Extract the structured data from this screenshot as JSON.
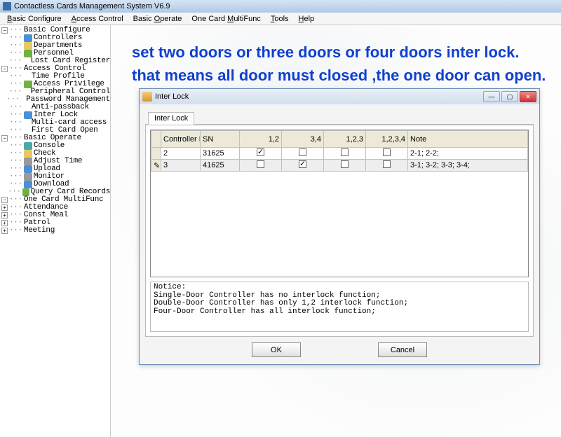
{
  "app": {
    "title": "Contactless Cards Management System  V6.9"
  },
  "menu": {
    "basic_configure": "Basic Configure",
    "access_control": "Access Control",
    "basic_operate": "Basic Operate",
    "one_card_multifunc": "One Card MultiFunc",
    "tools": "Tools",
    "help": "Help"
  },
  "tree": {
    "basic_configure": "Basic Configure",
    "controllers": "Controllers",
    "departments": "Departments",
    "personnel": "Personnel",
    "lost_card_register": "Lost Card Register",
    "access_control": "Access Control",
    "time_profile": "Time Profile",
    "access_privilege": "Access Privilege",
    "peripheral_control": "Peripheral Control",
    "password_management": "Password Management",
    "anti_passback": "Anti-passback",
    "inter_lock": "Inter Lock",
    "multi_card_access": "Multi-card access",
    "first_card_open": "First Card Open",
    "basic_operate": "Basic Operate",
    "console": "Console",
    "check": "Check",
    "adjust_time": "Adjust Time",
    "upload": "Upload",
    "monitor": "Monitor",
    "download": "Download",
    "query_card_records": "Query Card Records",
    "one_card_multifunc": "One Card MultiFunc",
    "attendance": "Attendance",
    "const_meal": "Const Meal",
    "patrol": "Patrol",
    "meeting": "Meeting"
  },
  "annotation": {
    "line1": "set two doors or three doors or four doors inter lock.",
    "line2": "that means all door must closed ,the one door can open."
  },
  "dialog": {
    "title": "Inter Lock",
    "tab": "Inter Lock",
    "columns": {
      "controller_no": "Controller No.",
      "sn": "SN",
      "c12": "1,2",
      "c34": "3,4",
      "c123": "1,2,3",
      "c1234": "1,2,3,4",
      "note": "Note"
    },
    "rows": [
      {
        "marker": "",
        "no": "2",
        "sn": "31625",
        "c12": true,
        "c34": false,
        "c123": false,
        "c1234": false,
        "note": "2-1;  2-2;"
      },
      {
        "marker": "✎",
        "no": "3",
        "sn": "41625",
        "c12": false,
        "c34": true,
        "c123": false,
        "c1234": false,
        "note": "3-1;  3-2;  3-3;  3-4;"
      }
    ],
    "notice": {
      "heading": "Notice:",
      "l1": "Single-Door Controller has no interlock function;",
      "l2": "Double-Door Controller has only 1,2 interlock function;",
      "l3": "Four-Door Controller has all interlock function;"
    },
    "buttons": {
      "ok": "OK",
      "cancel": "Cancel"
    }
  }
}
